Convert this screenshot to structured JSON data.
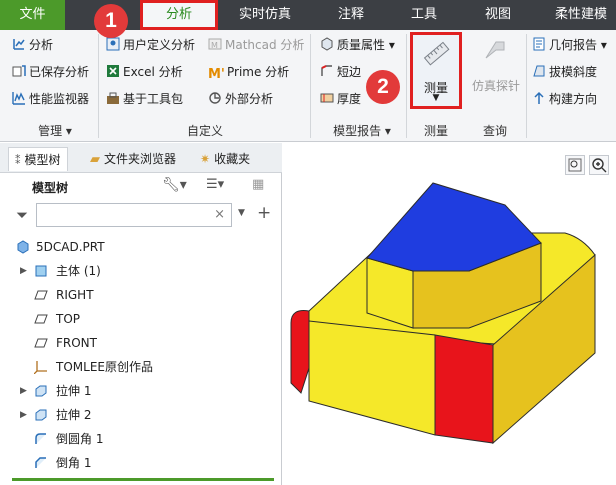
{
  "tabs": [
    {
      "label": "文件",
      "id": "file"
    },
    {
      "label": "分析",
      "id": "analysis"
    },
    {
      "label": "实时仿真",
      "id": "simulation"
    },
    {
      "label": "注释",
      "id": "annotate"
    },
    {
      "label": "工具",
      "id": "tools"
    },
    {
      "label": "视图",
      "id": "view"
    },
    {
      "label": "柔性建模",
      "id": "flex"
    }
  ],
  "markers": [
    "1",
    "2"
  ],
  "ribbon": {
    "manage": {
      "items": [
        "分析",
        "已保存分析",
        "性能监视器"
      ],
      "group_label": "管理"
    },
    "custom": {
      "items": [
        "用户定义分析",
        "Mathcad 分析",
        "Excel 分析",
        "Prime 分析",
        "基于工具包",
        "外部分析"
      ],
      "group_label": "自定义"
    },
    "model_report": {
      "items": [
        "质量属性",
        "短边",
        "厚度"
      ],
      "group_label": "模型报告"
    },
    "measure": {
      "button_label": "测量",
      "group_label": "测量"
    },
    "inspect": {
      "button_label": "仿真探针",
      "group_label": "查询"
    },
    "geometry": {
      "items": [
        "几何报告",
        "拔模斜度",
        "构建方向"
      ]
    }
  },
  "panel": {
    "tabs": [
      "模型树",
      "文件夹浏览器",
      "收藏夹"
    ],
    "toolbar_label": "模型树",
    "search": {
      "value": "",
      "placeholder": ""
    },
    "tree": [
      {
        "label": "5DCAD.PRT"
      },
      {
        "label": "主体 (1)"
      },
      {
        "label": "RIGHT"
      },
      {
        "label": "TOP"
      },
      {
        "label": "FRONT"
      },
      {
        "label": "TOMLEE原创作品"
      },
      {
        "label": "拉伸 1"
      },
      {
        "label": "拉伸 2"
      },
      {
        "label": "倒圆角 1"
      },
      {
        "label": "倒角 1"
      }
    ]
  },
  "colors": {
    "accent_green": "#4c9a2a",
    "highlight_red": "#e02020",
    "model_yellow": "#f5e829",
    "model_blue": "#1f3de0",
    "model_red": "#e8141b"
  }
}
